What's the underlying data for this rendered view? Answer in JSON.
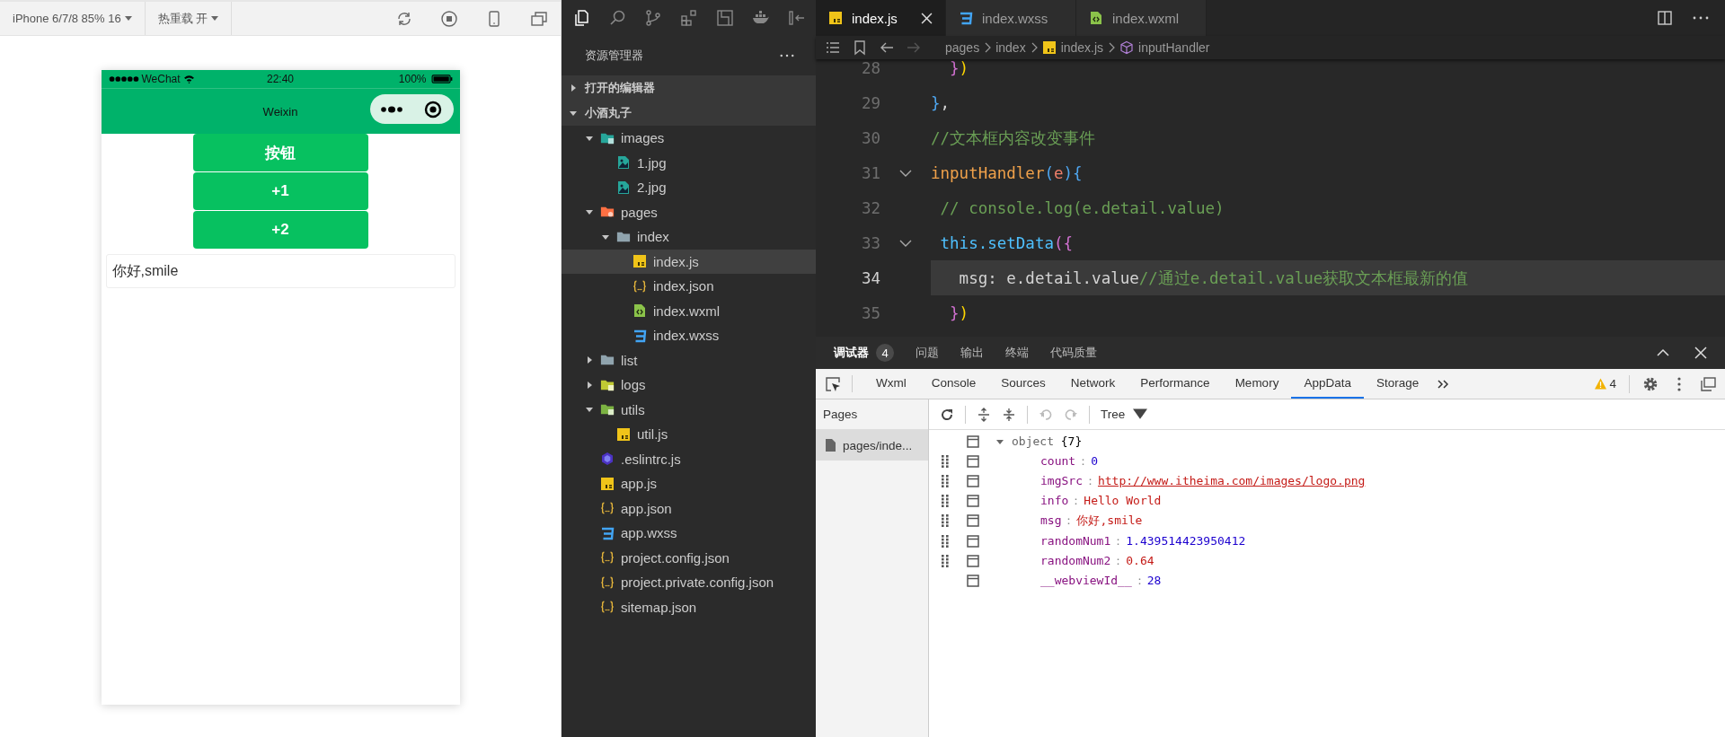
{
  "simulator": {
    "toolbar": {
      "device": "iPhone 6/7/8 85% 16",
      "hot_reload": "热重载 开"
    },
    "phone": {
      "carrier": "WeChat",
      "time": "22:40",
      "battery": "100%",
      "nav_title": "Weixin",
      "buttons": [
        "按钮",
        "+1",
        "+2"
      ],
      "input": {
        "value": "你好,smile"
      }
    }
  },
  "explorer": {
    "title": "资源管理器",
    "sections": [
      {
        "label": "打开的编辑器",
        "expanded": false
      },
      {
        "label": "小酒丸子",
        "expanded": true,
        "children": [
          {
            "label": "images",
            "kind": "folder-images",
            "expanded": true,
            "selected": false,
            "children": [
              {
                "label": "1.jpg",
                "kind": "image",
                "selected": false
              },
              {
                "label": "2.jpg",
                "kind": "image",
                "selected": false
              }
            ]
          },
          {
            "label": "pages",
            "kind": "folder-pages",
            "expanded": true,
            "selected": false,
            "children": [
              {
                "label": "index",
                "kind": "folder",
                "expanded": true,
                "selected": false,
                "children": [
                  {
                    "label": "index.js",
                    "kind": "js",
                    "selected": true
                  },
                  {
                    "label": "index.json",
                    "kind": "json",
                    "selected": false
                  },
                  {
                    "label": "index.wxml",
                    "kind": "wxml",
                    "selected": false
                  },
                  {
                    "label": "index.wxss",
                    "kind": "wxss",
                    "selected": false
                  }
                ]
              }
            ]
          },
          {
            "label": "list",
            "kind": "folder",
            "expanded": false,
            "selected": false
          },
          {
            "label": "logs",
            "kind": "folder-logs",
            "expanded": false,
            "selected": false
          },
          {
            "label": "utils",
            "kind": "folder-utils",
            "expanded": true,
            "selected": false,
            "children": [
              {
                "label": "util.js",
                "kind": "js",
                "selected": false
              }
            ]
          },
          {
            "label": ".eslintrc.js",
            "kind": "eslint",
            "selected": false
          },
          {
            "label": "app.js",
            "kind": "js",
            "selected": false
          },
          {
            "label": "app.json",
            "kind": "json",
            "selected": false
          },
          {
            "label": "app.wxss",
            "kind": "wxss",
            "selected": false
          },
          {
            "label": "project.config.json",
            "kind": "json",
            "selected": false
          },
          {
            "label": "project.private.config.json",
            "kind": "json",
            "selected": false
          },
          {
            "label": "sitemap.json",
            "kind": "json",
            "selected": false
          }
        ]
      }
    ]
  },
  "editor": {
    "tabs": [
      {
        "label": "index.js",
        "kind": "js",
        "selected": true
      },
      {
        "label": "index.wxss",
        "kind": "wxss",
        "selected": false
      },
      {
        "label": "index.wxml",
        "kind": "wxml",
        "selected": false
      }
    ],
    "breadcrumb": [
      {
        "label": "pages",
        "kind": "folder"
      },
      {
        "label": "index",
        "kind": "folder"
      },
      {
        "label": "index.js",
        "kind": "js"
      },
      {
        "label": "inputHandler",
        "kind": "method"
      }
    ],
    "lines": [
      {
        "number": "28",
        "current": false,
        "foldable": false,
        "segments": [
          {
            "text": "  }",
            "kind": "bracket-pink"
          },
          {
            "text": ")",
            "kind": "bracket-yellow"
          }
        ]
      },
      {
        "number": "29",
        "current": false,
        "foldable": false,
        "segments": [
          {
            "text": "}",
            "kind": "bracket-blue"
          },
          {
            "text": ",",
            "kind": "plain"
          }
        ]
      },
      {
        "number": "30",
        "current": false,
        "foldable": false,
        "segments": [
          {
            "text": "//文本框内容改变事件",
            "kind": "comment"
          }
        ]
      },
      {
        "number": "31",
        "current": false,
        "foldable": true,
        "segments": [
          {
            "text": "inputHandler",
            "kind": "function"
          },
          {
            "text": "(",
            "kind": "bracket-blue"
          },
          {
            "text": "e",
            "kind": "param"
          },
          {
            "text": "){",
            "kind": "bracket-blue"
          }
        ]
      },
      {
        "number": "32",
        "current": false,
        "foldable": false,
        "segments": [
          {
            "text": " // console.log(e.detail.value)",
            "kind": "comment"
          }
        ]
      },
      {
        "number": "33",
        "current": false,
        "foldable": true,
        "segments": [
          {
            "text": " this.setData",
            "kind": "keyword"
          },
          {
            "text": "({",
            "kind": "bracket-pink"
          }
        ]
      },
      {
        "number": "34",
        "current": true,
        "foldable": false,
        "segments": [
          {
            "text": "   msg: e.detail.value",
            "kind": "plain"
          },
          {
            "text": "//通过e.detail.value获取文本框最新的值",
            "kind": "comment"
          }
        ]
      },
      {
        "number": "35",
        "current": false,
        "foldable": false,
        "segments": [
          {
            "text": "  }",
            "kind": "bracket-pink"
          },
          {
            "text": ")",
            "kind": "bracket-yellow"
          }
        ]
      }
    ]
  },
  "devtools": {
    "panel_tabs": [
      {
        "label": "调试器",
        "badge": "4",
        "selected": true
      },
      {
        "label": "问题",
        "selected": false
      },
      {
        "label": "输出",
        "selected": false
      },
      {
        "label": "终端",
        "selected": false
      },
      {
        "label": "代码质量",
        "selected": false
      }
    ],
    "tabs": [
      {
        "label": "Wxml",
        "selected": false
      },
      {
        "label": "Console",
        "selected": false
      },
      {
        "label": "Sources",
        "selected": false
      },
      {
        "label": "Network",
        "selected": false
      },
      {
        "label": "Performance",
        "selected": false
      },
      {
        "label": "Memory",
        "selected": false
      },
      {
        "label": "AppData",
        "selected": true
      },
      {
        "label": "Storage",
        "selected": false
      }
    ],
    "warnings": "4",
    "pages_header": "Pages",
    "pages": [
      {
        "label": "pages/inde...",
        "selected": true
      }
    ],
    "view_mode": "Tree",
    "tree": {
      "label": "object",
      "count": "{7}",
      "expanded": true,
      "children": [
        {
          "key": "count",
          "separator": "：",
          "value": "0",
          "kind": "number",
          "draggable": true
        },
        {
          "key": "imgSrc",
          "separator": "：",
          "value": "http://www.itheima.com/images/logo.png",
          "kind": "url",
          "draggable": true
        },
        {
          "key": "info",
          "separator": "：",
          "value": "Hello World",
          "kind": "string",
          "draggable": true
        },
        {
          "key": "msg",
          "separator": "：",
          "value": "你好,smile",
          "kind": "string",
          "draggable": true
        },
        {
          "key": "randomNum1",
          "separator": "：",
          "value": "1.439514423950412",
          "kind": "number",
          "draggable": true
        },
        {
          "key": "randomNum2",
          "separator": "：",
          "value": "0.64",
          "kind": "string",
          "draggable": true
        },
        {
          "key": "__webviewId__",
          "separator": "：",
          "value": "28",
          "kind": "number",
          "draggable": false
        }
      ]
    }
  }
}
